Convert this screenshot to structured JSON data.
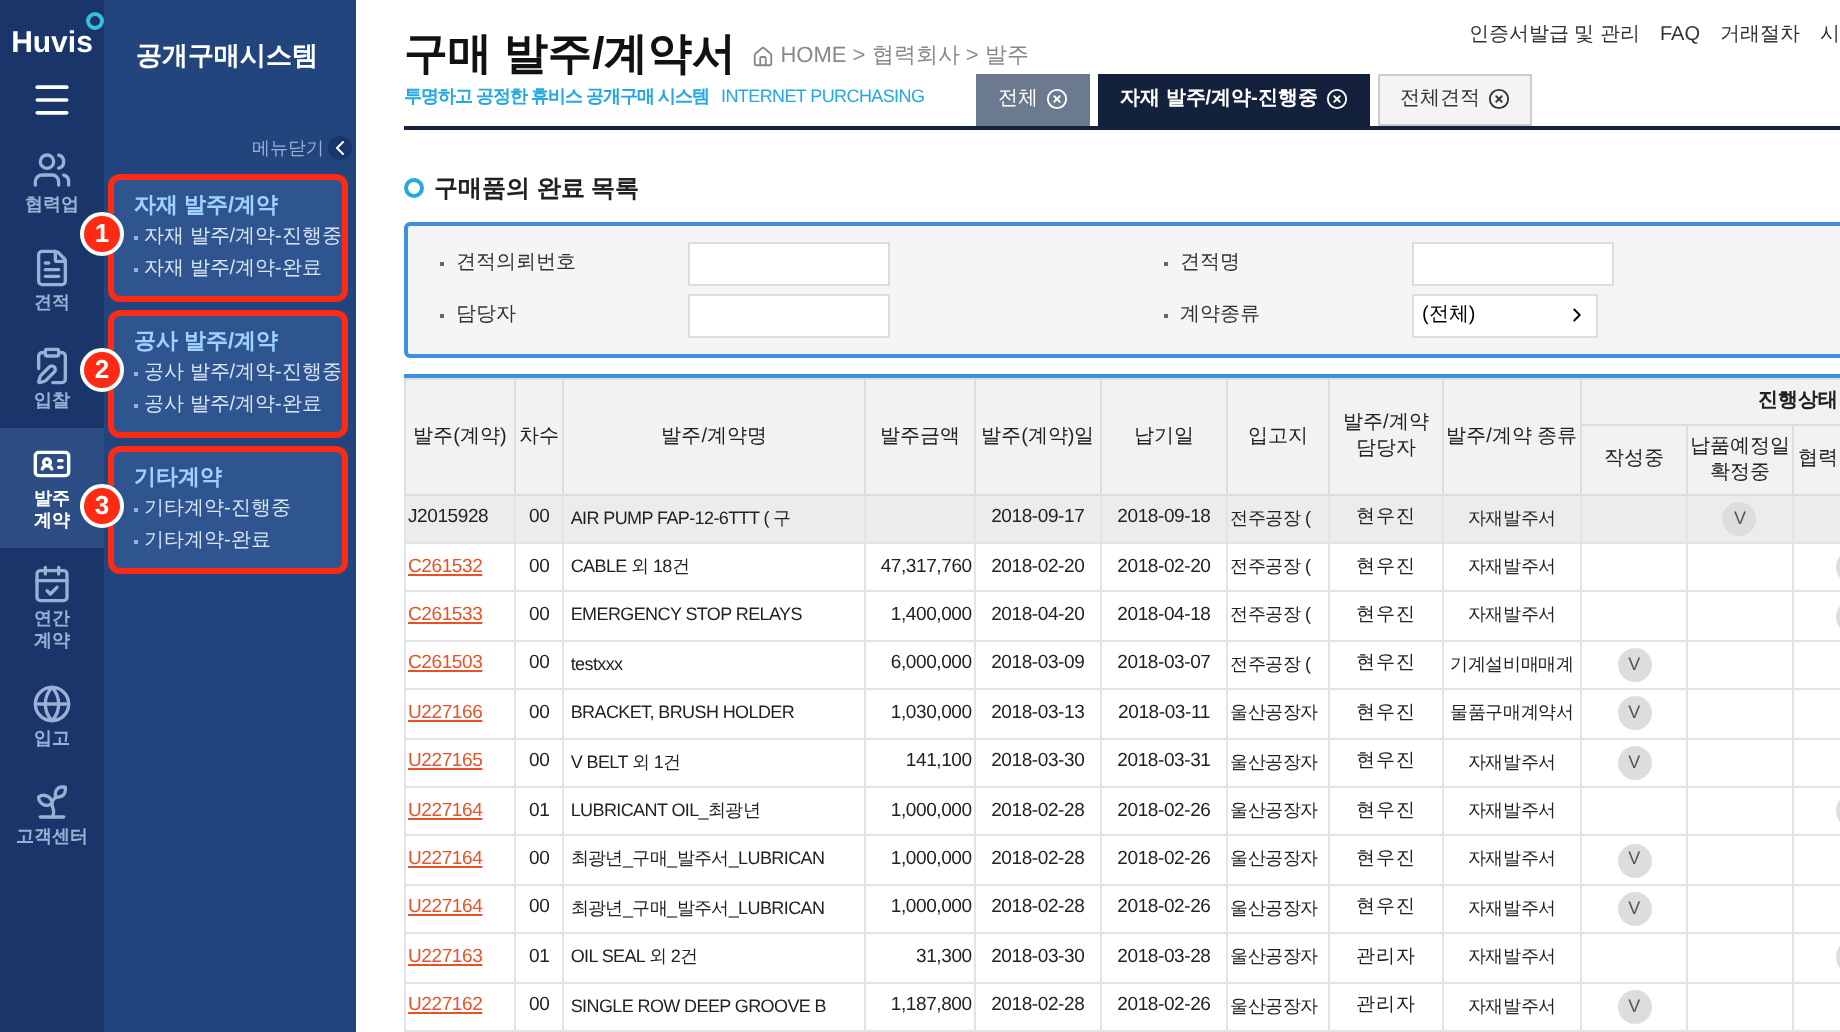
{
  "rail": {
    "logo": "Huvis",
    "items": [
      {
        "label": "협력업",
        "selected": false
      },
      {
        "label": "견적",
        "selected": false
      },
      {
        "label": "입찰",
        "selected": false
      },
      {
        "label": "발주 계약",
        "selected": true
      },
      {
        "label": "연간 계약",
        "selected": false
      },
      {
        "label": "입고",
        "selected": false
      },
      {
        "label": "고객센터",
        "selected": false
      }
    ]
  },
  "submenu": {
    "title": "공개구매시스템",
    "close_label": "메뉴닫기",
    "groups": [
      {
        "callout": "1",
        "title": "자재 발주/계약",
        "items": [
          "자재 발주/계약-진행중",
          "자재 발주/계약-완료"
        ]
      },
      {
        "callout": "2",
        "title": "공사 발주/계약",
        "items": [
          "공사 발주/계약-진행중",
          "공사 발주/계약-완료"
        ]
      },
      {
        "callout": "3",
        "title": "기타계약",
        "items": [
          "기타계약-진행중",
          "기타계약-완료"
        ]
      }
    ]
  },
  "header": {
    "title": "구매 발주/계약서",
    "breadcrumb": "HOME > 협력회사 > 발주",
    "subtitle": "투명하고 공정한 휴비스 공개구매 시스템",
    "subtitle_en": "INTERNET PURCHASING",
    "top_links": [
      "인증서발급 및 관리",
      "FAQ",
      "거래절차",
      "시"
    ]
  },
  "tabs": [
    {
      "label": "전체",
      "kind": "grey",
      "selected": false
    },
    {
      "label": "자재 발주/계약-진행중",
      "kind": "dark",
      "selected": true
    },
    {
      "label": "전체견적",
      "kind": "light",
      "selected": false
    }
  ],
  "section_title": "구매품의 완료 목록",
  "filters": [
    {
      "label": "견적의뢰번호",
      "kind": "input"
    },
    {
      "label": "견적명",
      "kind": "input"
    },
    {
      "label": "담당자",
      "kind": "input"
    },
    {
      "label": "계약종류",
      "kind": "select",
      "value": "(전체)"
    }
  ],
  "table": {
    "columns": [
      "발주(계약)",
      "차수",
      "발주/계약명",
      "발주금액",
      "발주(계약)일",
      "납기일",
      "입고지",
      "발주/계약 담당자",
      "발주/계약 종류"
    ],
    "status_group": "진행상태",
    "status_columns": [
      "작성중",
      "납품예정일 확정중",
      "협력"
    ],
    "rows": [
      {
        "no": "J2015928",
        "link": false,
        "selected": true,
        "rev": "00",
        "name": "AIR PUMP  FAP-12-6TTT ( 구",
        "amount": "",
        "order_date": "2018-09-17",
        "due": "2018-09-18",
        "site": "전주공장 (",
        "manager": "현우진",
        "type": "자재발주서",
        "kind": "confirming",
        "check": "V"
      },
      {
        "no": "C261532",
        "link": true,
        "selected": false,
        "rev": "00",
        "name": "CABLE 외 18건",
        "amount": "47,317,760",
        "order_date": "2018-02-20",
        "due": "2018-02-20",
        "site": "전주공장 (",
        "manager": "현우진",
        "type": "자재발주서",
        "kind": "partner"
      },
      {
        "no": "C261533",
        "link": true,
        "selected": false,
        "rev": "00",
        "name": "EMERGENCY STOP RELAYS",
        "amount": "1,400,000",
        "order_date": "2018-04-20",
        "due": "2018-04-18",
        "site": "전주공장 (",
        "manager": "현우진",
        "type": "자재발주서",
        "kind": "partner"
      },
      {
        "no": "C261503",
        "link": true,
        "selected": false,
        "rev": "00",
        "name": "testxxx",
        "amount": "6,000,000",
        "order_date": "2018-03-09",
        "due": "2018-03-07",
        "site": "전주공장 (",
        "manager": "현우진",
        "type": "기계설비매매계",
        "kind": "writing",
        "check": "V"
      },
      {
        "no": "U227166",
        "link": true,
        "selected": false,
        "rev": "00",
        "name": "BRACKET, BRUSH HOLDER",
        "amount": "1,030,000",
        "order_date": "2018-03-13",
        "due": "2018-03-11",
        "site": "울산공장자",
        "manager": "현우진",
        "type": "물품구매계약서",
        "kind": "writing",
        "check": "V"
      },
      {
        "no": "U227165",
        "link": true,
        "selected": false,
        "rev": "00",
        "name": "V BELT 외 1건",
        "amount": "141,100",
        "order_date": "2018-03-30",
        "due": "2018-03-31",
        "site": "울산공장자",
        "manager": "현우진",
        "type": "자재발주서",
        "kind": "writing",
        "check": "V"
      },
      {
        "no": "U227164",
        "link": true,
        "selected": false,
        "rev": "01",
        "name": "LUBRICANT OIL_최광년",
        "amount": "1,000,000",
        "order_date": "2018-02-28",
        "due": "2018-02-26",
        "site": "울산공장자",
        "manager": "현우진",
        "type": "자재발주서",
        "kind": "partner"
      },
      {
        "no": "U227164",
        "link": true,
        "selected": false,
        "rev": "00",
        "name": "최광년_구매_발주서_LUBRICAN",
        "amount": "1,000,000",
        "order_date": "2018-02-28",
        "due": "2018-02-26",
        "site": "울산공장자",
        "manager": "현우진",
        "type": "자재발주서",
        "kind": "writing",
        "check": "V"
      },
      {
        "no": "U227164",
        "link": true,
        "selected": false,
        "rev": "00",
        "name": "최광년_구매_발주서_LUBRICAN",
        "amount": "1,000,000",
        "order_date": "2018-02-28",
        "due": "2018-02-26",
        "site": "울산공장자",
        "manager": "현우진",
        "type": "자재발주서",
        "kind": "writing",
        "check": "V"
      },
      {
        "no": "U227163",
        "link": true,
        "selected": false,
        "rev": "01",
        "name": "OIL SEAL 외 2건",
        "amount": "31,300",
        "order_date": "2018-03-30",
        "due": "2018-03-28",
        "site": "울산공장자",
        "manager": "관리자",
        "type": "자재발주서",
        "kind": "partner"
      },
      {
        "no": "U227162",
        "link": true,
        "selected": false,
        "rev": "00",
        "name": "SINGLE ROW DEEP GROOVE B",
        "amount": "1,187,800",
        "order_date": "2018-02-28",
        "due": "2018-02-26",
        "site": "울산공장자",
        "manager": "관리자",
        "type": "자재발주서",
        "kind": "writing",
        "check": "V"
      }
    ]
  }
}
